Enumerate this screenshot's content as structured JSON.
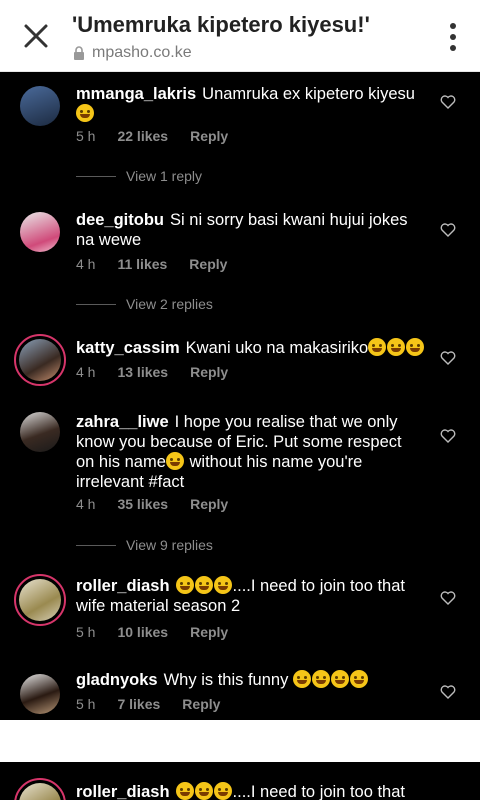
{
  "header": {
    "title": "'Umemruka kipetero kiyesu!'",
    "url": "mpasho.co.ke"
  },
  "comments": [
    {
      "user": "mmanga_lakris",
      "text": "Unamruka ex kipetero kiyesu",
      "time": "5 h",
      "likes": "22 likes",
      "reply": "Reply",
      "replies": "View 1 reply"
    },
    {
      "user": "dee_gitobu",
      "text": "Si ni sorry basi kwani hujui jokes na wewe",
      "time": "4 h",
      "likes": "11 likes",
      "reply": "Reply",
      "replies": "View 2 replies"
    },
    {
      "user": "katty_cassim",
      "text": "Kwani uko na makasiriko",
      "time": "4 h",
      "likes": "13 likes",
      "reply": "Reply"
    },
    {
      "user": "zahra__liwe",
      "text": "I hope you realise that we only know you because of Eric. Put some respect on his name",
      "text2": "without his name you're irrelevant #fact",
      "time": "4 h",
      "likes": "35 likes",
      "reply": "Reply",
      "replies": "View 9 replies"
    },
    {
      "user": "roller_diash",
      "text": "....I need to join too that wife material season 2",
      "time": "5 h",
      "likes": "10 likes",
      "reply": "Reply"
    },
    {
      "user": "gladnyoks",
      "text": "Why is this funny",
      "time": "5 h",
      "likes": "7 likes",
      "reply": "Reply"
    }
  ],
  "bottom_comment": {
    "user": "roller_diash",
    "text": "....I need to join too that"
  },
  "colors": {
    "accent_ring": "#d6356a",
    "feed_bg": "#000000",
    "meta": "#8e8e8e"
  },
  "icons": [
    "close-icon",
    "lock-icon",
    "kebab-menu-icon",
    "heart-icon"
  ]
}
